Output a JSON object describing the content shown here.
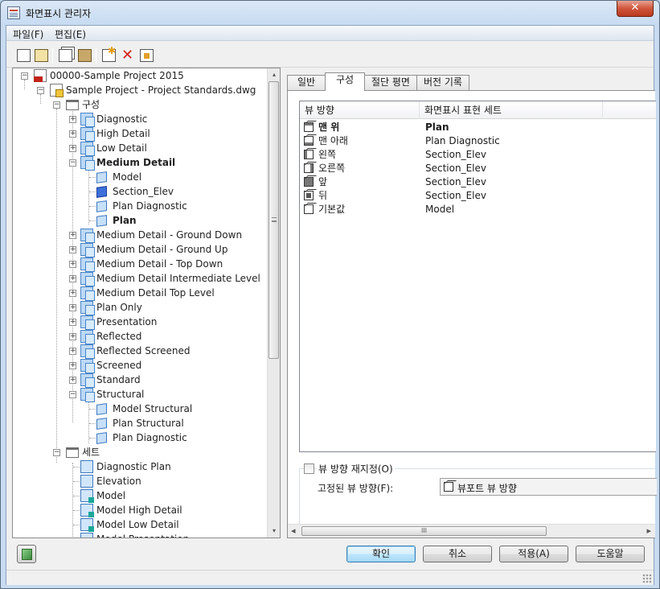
{
  "window": {
    "title": "화면표시 관리자",
    "close_glyph": "✕"
  },
  "menu": {
    "file": "파일(F)",
    "edit": "편집(E)"
  },
  "toolbar": {
    "buttons": [
      "new-document-icon",
      "open-folder-icon",
      "copy-icon",
      "paste-icon",
      "new-item-icon",
      "delete-icon",
      "purge-icon"
    ]
  },
  "tree": {
    "root": "00000-Sample Project 2015",
    "drawing": "Sample Project - Project Standards.dwg",
    "config_folder": "구성",
    "configs": [
      "Diagnostic",
      "High Detail",
      "Low Detail",
      "Medium Detail",
      "Medium Detail - Ground Down",
      "Medium Detail - Ground Up",
      "Medium Detail - Top Down",
      "Medium Detail Intermediate Level",
      "Medium Detail Top Level",
      "Plan Only",
      "Presentation",
      "Reflected",
      "Reflected Screened",
      "Screened",
      "Standard",
      "Structural"
    ],
    "medium_detail_children": [
      "Model",
      "Section_Elev",
      "Plan Diagnostic",
      "Plan"
    ],
    "structural_children": [
      "Model Structural",
      "Plan Structural",
      "Plan Diagnostic"
    ],
    "sets_folder": "세트",
    "sets": [
      "Diagnostic Plan",
      "Elevation",
      "Model",
      "Model High Detail",
      "Model Low Detail",
      "Model Presentation"
    ],
    "expand_plus": "+",
    "expand_minus": "−"
  },
  "tabs": [
    "일반",
    "구성",
    "절단 평면",
    "버전 기록"
  ],
  "active_tab": "구성",
  "list": {
    "col_direction": "뷰 방향",
    "col_representation": "화면표시 표현 세트",
    "rows": [
      {
        "direction": "맨 위",
        "rep": "Plan"
      },
      {
        "direction": "맨 아래",
        "rep": "Plan Diagnostic"
      },
      {
        "direction": "왼쪽",
        "rep": "Section_Elev"
      },
      {
        "direction": "오른쪽",
        "rep": "Section_Elev"
      },
      {
        "direction": "앞",
        "rep": "Section_Elev"
      },
      {
        "direction": "뒤",
        "rep": "Section_Elev"
      },
      {
        "direction": "기본값",
        "rep": "Model"
      }
    ]
  },
  "override": {
    "checkbox_label": "뷰 방향 재지정(O)",
    "checked": false,
    "fixed_label": "고정된 뷰 방향(F):",
    "fixed_value": "뷰포트 뷰 방향"
  },
  "scroll": {
    "left_arrow": "◂",
    "right_arrow": "▸",
    "grip": "III",
    "up_arrow": "▴",
    "down_arrow": "▾"
  },
  "buttons": {
    "ok": "확인",
    "cancel": "취소",
    "apply": "적용(A)",
    "help": "도움말"
  }
}
